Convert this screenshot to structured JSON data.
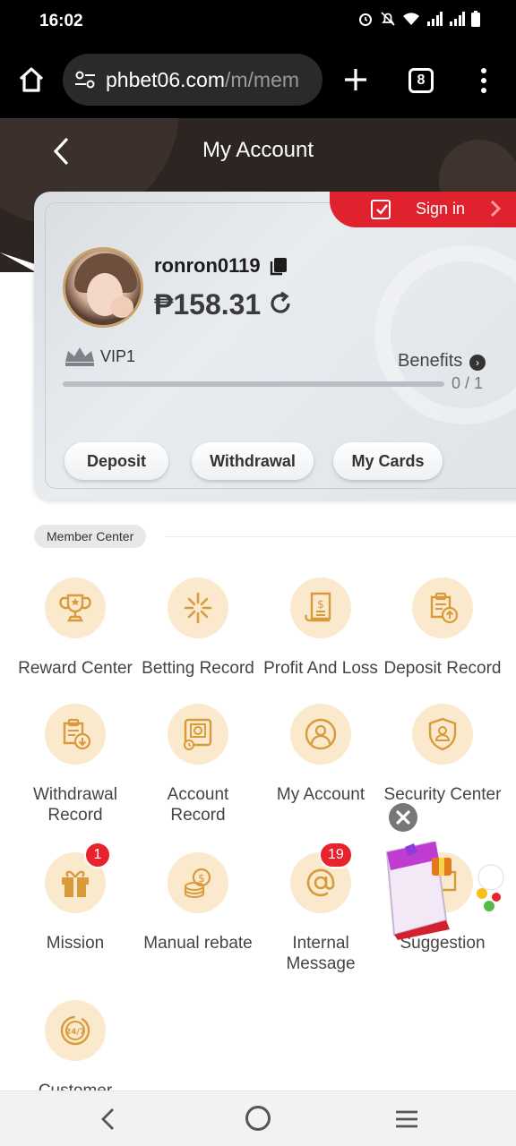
{
  "status_bar": {
    "time": "16:02"
  },
  "browser": {
    "url_host": "phbet06.com",
    "url_path": "/m/mem",
    "tab_count": "8"
  },
  "header": {
    "title": "My Account"
  },
  "account": {
    "sign_in_label": "Sign in",
    "username": "ronron0119",
    "balance": "₱158.31",
    "vip_label": "VIP1",
    "benefits_label": "Benefits",
    "vip_progress_text": "0 / 1",
    "vip_progress_fraction": 0,
    "buttons": {
      "deposit": "Deposit",
      "withdrawal": "Withdrawal",
      "my_cards": "My Cards"
    }
  },
  "member_center": {
    "section_label": "Member Center",
    "items": [
      {
        "label": "Reward Center",
        "icon": "trophy-icon"
      },
      {
        "label": "Betting Record",
        "icon": "betting-icon"
      },
      {
        "label": "Profit And Loss",
        "icon": "document-icon"
      },
      {
        "label": "Deposit Record",
        "icon": "clipboard-upload-icon"
      },
      {
        "label": "Withdrawal\nRecord",
        "label_line1": "Withdrawal",
        "label_line2": "Record",
        "icon": "clipboard-download-icon"
      },
      {
        "label_line1": "Account",
        "label_line2": "Record",
        "icon": "account-record-icon"
      },
      {
        "label": "My Account",
        "icon": "user-icon"
      },
      {
        "label": "Security Center",
        "icon": "shield-user-icon"
      },
      {
        "label": "Mission",
        "icon": "gift-icon",
        "badge": "1"
      },
      {
        "label": "Manual rebate",
        "icon": "coins-icon"
      },
      {
        "label_line1": "Internal",
        "label_line2": "Message",
        "icon": "at-icon",
        "badge": "19"
      },
      {
        "label": "Suggestion",
        "icon": "suggestion-icon"
      },
      {
        "label": "Customer",
        "icon": "support-24-7-icon"
      }
    ]
  },
  "colors": {
    "accent_red": "#e0212e",
    "icon_circle": "#fbe9cd",
    "icon_stroke": "#d99a3a",
    "header_dark": "#2c2522"
  }
}
